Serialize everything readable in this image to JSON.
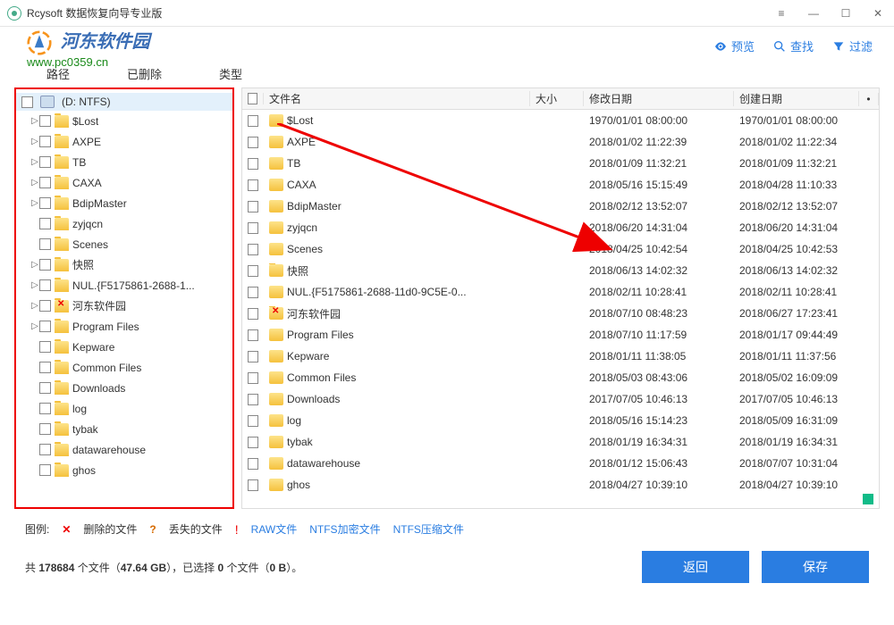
{
  "titlebar": {
    "title": "Rcysoft 数据恢复向导专业版"
  },
  "toolbar": {
    "preview": "预览",
    "search": "查找",
    "filter": "过滤"
  },
  "tabs": {
    "path": "路径",
    "deleted": "已删除",
    "type": "类型"
  },
  "tree": {
    "drive": "(D: NTFS)",
    "items": [
      {
        "label": "$Lost",
        "caret": true
      },
      {
        "label": "AXPE",
        "caret": true
      },
      {
        "label": "TB",
        "caret": true
      },
      {
        "label": "CAXA",
        "caret": true
      },
      {
        "label": "BdipMaster",
        "caret": true
      },
      {
        "label": "zyjqcn",
        "caret": false
      },
      {
        "label": "Scenes",
        "caret": false
      },
      {
        "label": "快照",
        "caret": true
      },
      {
        "label": "NUL.{F5175861-2688-1...",
        "caret": true
      },
      {
        "label": "河东软件园",
        "caret": true,
        "deleted": true
      },
      {
        "label": "Program Files",
        "caret": true
      },
      {
        "label": "Kepware",
        "caret": false
      },
      {
        "label": "Common Files",
        "caret": false
      },
      {
        "label": "Downloads",
        "caret": false
      },
      {
        "label": "log",
        "caret": false
      },
      {
        "label": "tybak",
        "caret": false
      },
      {
        "label": "datawarehouse",
        "caret": false
      },
      {
        "label": "ghos",
        "caret": false
      }
    ]
  },
  "table": {
    "headers": {
      "name": "文件名",
      "size": "大小",
      "mod": "修改日期",
      "cre": "创建日期"
    },
    "rows": [
      {
        "name": "$Lost",
        "mod": "1970/01/01 08:00:00",
        "cre": "1970/01/01 08:00:00"
      },
      {
        "name": "AXPE",
        "mod": "2018/01/02 11:22:39",
        "cre": "2018/01/02 11:22:34"
      },
      {
        "name": "TB",
        "mod": "2018/01/09 11:32:21",
        "cre": "2018/01/09 11:32:21"
      },
      {
        "name": "CAXA",
        "mod": "2018/05/16 15:15:49",
        "cre": "2018/04/28 11:10:33"
      },
      {
        "name": "BdipMaster",
        "mod": "2018/02/12 13:52:07",
        "cre": "2018/02/12 13:52:07"
      },
      {
        "name": "zyjqcn",
        "mod": "2018/06/20 14:31:04",
        "cre": "2018/06/20 14:31:04"
      },
      {
        "name": "Scenes",
        "mod": "2018/04/25 10:42:54",
        "cre": "2018/04/25 10:42:53"
      },
      {
        "name": "快照",
        "mod": "2018/06/13 14:02:32",
        "cre": "2018/06/13 14:02:32"
      },
      {
        "name": "NUL.{F5175861-2688-11d0-9C5E-0...",
        "mod": "2018/02/11 10:28:41",
        "cre": "2018/02/11 10:28:41"
      },
      {
        "name": "河东软件园",
        "mod": "2018/07/10 08:48:23",
        "cre": "2018/06/27 17:23:41",
        "deleted": true
      },
      {
        "name": "Program Files",
        "mod": "2018/07/10 11:17:59",
        "cre": "2018/01/17 09:44:49"
      },
      {
        "name": "Kepware",
        "mod": "2018/01/11 11:38:05",
        "cre": "2018/01/11 11:37:56"
      },
      {
        "name": "Common Files",
        "mod": "2018/05/03 08:43:06",
        "cre": "2018/05/02 16:09:09"
      },
      {
        "name": "Downloads",
        "mod": "2017/07/05 10:46:13",
        "cre": "2017/07/05 10:46:13"
      },
      {
        "name": "log",
        "mod": "2018/05/16 15:14:23",
        "cre": "2018/05/09 16:31:09"
      },
      {
        "name": "tybak",
        "mod": "2018/01/19 16:34:31",
        "cre": "2018/01/19 16:34:31"
      },
      {
        "name": "datawarehouse",
        "mod": "2018/01/12 15:06:43",
        "cre": "2018/07/07 10:31:04"
      },
      {
        "name": "ghos",
        "mod": "2018/04/27 10:39:10",
        "cre": "2018/04/27 10:39:10"
      }
    ]
  },
  "legend": {
    "label": "图例:",
    "deleted": "删除的文件",
    "lost": "丢失的文件",
    "raw": "RAW文件",
    "enc": "NTFS加密文件",
    "comp": "NTFS压缩文件"
  },
  "status": {
    "p1": "共 ",
    "count": "178684 ",
    "p2": "个文件（",
    "size": "47.64 GB",
    "p3": "），已选择 ",
    "sel_count": "0",
    "p4": " 个文件（",
    "sel_size": "0 B",
    "p5": "）。"
  },
  "buttons": {
    "back": "返回",
    "save": "保存"
  },
  "watermark": {
    "name": "河东软件园",
    "url": "www.pc0359.cn"
  }
}
